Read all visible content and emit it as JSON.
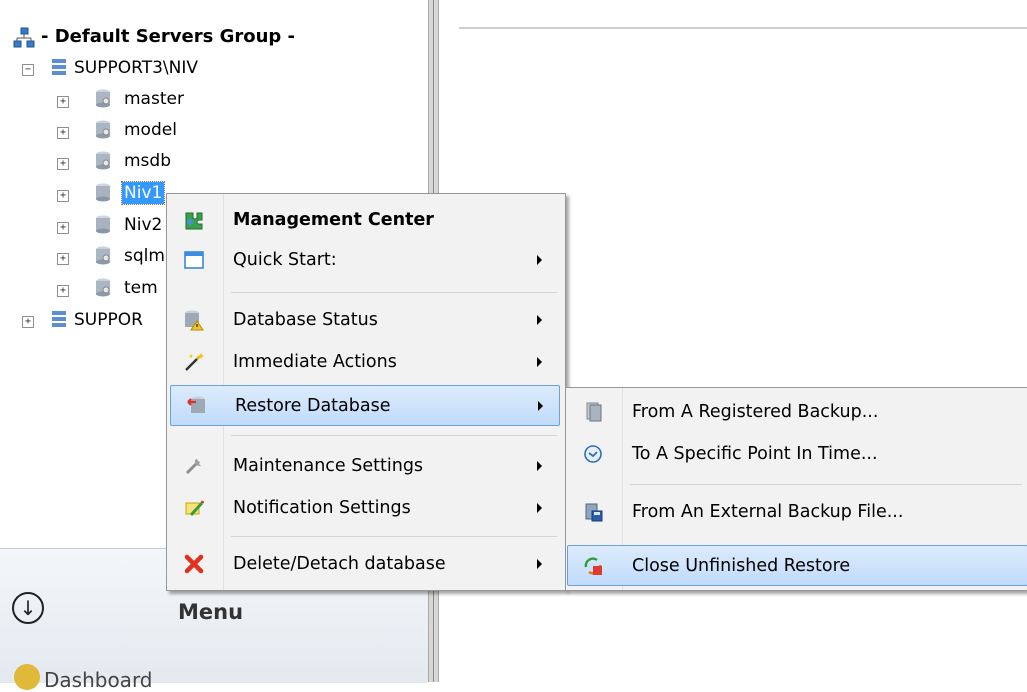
{
  "tree": {
    "group_title": "- Default Servers Group -",
    "servers": [
      {
        "label": "SUPPORT3\\NIV",
        "expander": "−"
      },
      {
        "label": "SUPPOR",
        "expander": "+"
      }
    ],
    "databases": [
      {
        "label": "master",
        "expander": "+"
      },
      {
        "label": "model",
        "expander": "+"
      },
      {
        "label": "msdb",
        "expander": "+"
      },
      {
        "label": "Niv1",
        "expander": "+"
      },
      {
        "label": "Niv2",
        "expander": "+"
      },
      {
        "label": "sqlm",
        "expander": "+"
      },
      {
        "label": "tem",
        "expander": "+"
      }
    ]
  },
  "bottom_menu": {
    "title": "Menu",
    "dashboard": "Dashboard"
  },
  "context_menu": {
    "items": [
      {
        "label": "Management Center",
        "icon": "management-center-icon",
        "bold": true,
        "submenu": false
      },
      {
        "label": "Quick Start:",
        "icon": "quick-start-icon",
        "submenu": true
      },
      {
        "label": "Database Status",
        "icon": "database-status-icon",
        "submenu": true
      },
      {
        "label": "Immediate Actions",
        "icon": "magic-wand-icon",
        "submenu": true
      },
      {
        "label": "Restore Database",
        "icon": "restore-database-icon",
        "submenu": true,
        "highlighted": true
      },
      {
        "label": "Maintenance Settings",
        "icon": "wrench-icon",
        "submenu": true
      },
      {
        "label": "Notification Settings",
        "icon": "notification-pencil-icon",
        "submenu": true
      },
      {
        "label": "Delete/Detach database",
        "icon": "red-x-icon",
        "submenu": true
      }
    ]
  },
  "restore_submenu": {
    "items": [
      {
        "label": "From A Registered Backup...",
        "icon": "registered-backup-icon"
      },
      {
        "label": "To A Specific Point In Time...",
        "icon": "clock-icon"
      },
      {
        "label": "From An External Backup File...",
        "icon": "external-backup-file-icon"
      },
      {
        "label": "Close Unfinished Restore",
        "icon": "close-restore-icon",
        "highlighted": true
      }
    ]
  },
  "colors": {
    "selection": "#3399ff",
    "menu_bg": "#f2f2f2",
    "hover_bg": "#c1dbfc",
    "hover_border": "#6aa1e0"
  }
}
